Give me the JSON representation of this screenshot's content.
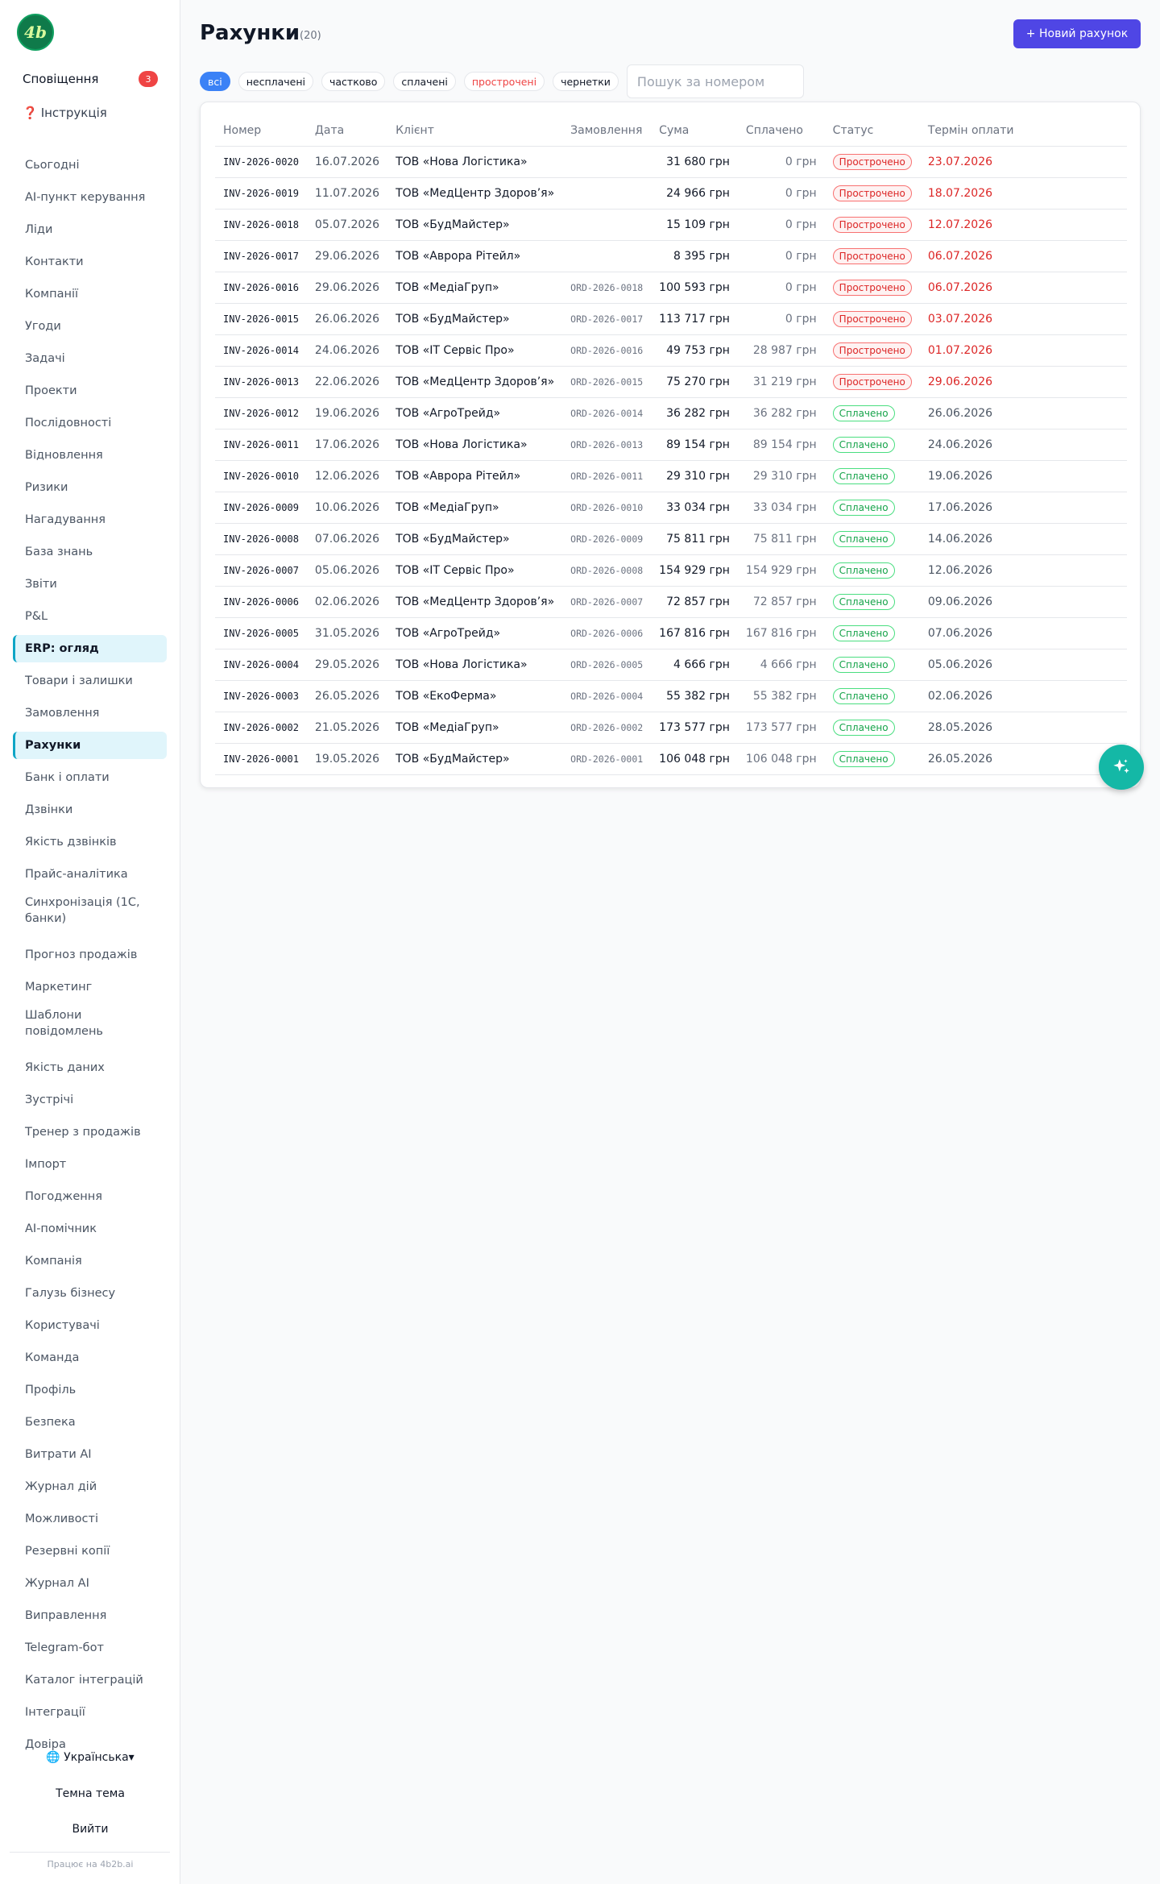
{
  "sidebar": {
    "logo_text": "4b",
    "notifications_label": "Сповіщення",
    "notifications_count": "3",
    "guide_icon": "❓",
    "guide_label": "Інструкція",
    "items": [
      {
        "label": "Сьогодні"
      },
      {
        "label": "AI-пункт керування"
      },
      {
        "label": "Ліди"
      },
      {
        "label": "Контакти"
      },
      {
        "label": "Компанії"
      },
      {
        "label": "Угоди"
      },
      {
        "label": "Задачі"
      },
      {
        "label": "Проекти"
      },
      {
        "label": "Послідовності"
      },
      {
        "label": "Відновлення"
      },
      {
        "label": "Ризики"
      },
      {
        "label": "Нагадування"
      },
      {
        "label": "База знань"
      },
      {
        "label": "Звіти"
      },
      {
        "label": "P&L"
      },
      {
        "label": "ERP: огляд",
        "active": true
      },
      {
        "label": "Товари і залишки"
      },
      {
        "label": "Замовлення"
      },
      {
        "label": "Рахунки",
        "active": true
      },
      {
        "label": "Банк і оплати"
      },
      {
        "label": "Дзвінки"
      },
      {
        "label": "Якість дзвінків"
      },
      {
        "label": "Прайс-аналітика"
      },
      {
        "label": "Синхронізація (1С, банки)"
      },
      {
        "label": "Прогноз продажів"
      },
      {
        "label": "Маркетинг"
      },
      {
        "label": "Шаблони повідомлень"
      },
      {
        "label": "Якість даних"
      },
      {
        "label": "Зустрічі"
      },
      {
        "label": "Тренер з продажів"
      },
      {
        "label": "Імпорт"
      },
      {
        "label": "Погодження"
      },
      {
        "label": "AI-помічник"
      },
      {
        "label": "Компанія"
      },
      {
        "label": "Галузь бізнесу"
      },
      {
        "label": "Користувачі"
      },
      {
        "label": "Команда"
      },
      {
        "label": "Профіль"
      },
      {
        "label": "Безпека"
      },
      {
        "label": "Витрати AI"
      },
      {
        "label": "Журнал дій"
      },
      {
        "label": "Можливості"
      },
      {
        "label": "Резервні копії"
      },
      {
        "label": "Журнал AI"
      },
      {
        "label": "Виправлення"
      },
      {
        "label": "Telegram-бот"
      },
      {
        "label": "Каталог інтеграцій"
      },
      {
        "label": "Інтеграції"
      },
      {
        "label": "Довіра"
      }
    ],
    "language_label": "🌐 Українська▾",
    "theme_label": "Темна тема",
    "logout_label": "Вийти",
    "powered_by": "Працює на 4b2b.ai"
  },
  "header": {
    "title": "Рахунки",
    "count": "(20)",
    "new_button": "+ Новий рахунок"
  },
  "filters": {
    "chips": [
      {
        "label": "всі",
        "active": true
      },
      {
        "label": "несплачені"
      },
      {
        "label": "частково"
      },
      {
        "label": "сплачені"
      },
      {
        "label": "прострочені",
        "danger": true
      },
      {
        "label": "чернетки"
      }
    ],
    "search_placeholder": "Пошук за номером"
  },
  "table": {
    "columns": [
      "Номер",
      "Дата",
      "Клієнт",
      "Замовлення",
      "Сума",
      "Сплачено",
      "Статус",
      "Термін оплати"
    ],
    "rows": [
      {
        "number": "INV-2026-0020",
        "date": "16.07.2026",
        "client": "ТОВ «Нова Логістика»",
        "order": "",
        "sum": "31 680 грн",
        "paid": "0 грн",
        "status": "Прострочено",
        "status_type": "overdue",
        "due": "23.07.2026"
      },
      {
        "number": "INV-2026-0019",
        "date": "11.07.2026",
        "client": "ТОВ «МедЦентр Здоров’я»",
        "order": "",
        "sum": "24 966 грн",
        "paid": "0 грн",
        "status": "Прострочено",
        "status_type": "overdue",
        "due": "18.07.2026"
      },
      {
        "number": "INV-2026-0018",
        "date": "05.07.2026",
        "client": "ТОВ «БудМайстер»",
        "order": "",
        "sum": "15 109 грн",
        "paid": "0 грн",
        "status": "Прострочено",
        "status_type": "overdue",
        "due": "12.07.2026"
      },
      {
        "number": "INV-2026-0017",
        "date": "29.06.2026",
        "client": "ТОВ «Аврора Рітейл»",
        "order": "",
        "sum": "8 395 грн",
        "paid": "0 грн",
        "status": "Прострочено",
        "status_type": "overdue",
        "due": "06.07.2026"
      },
      {
        "number": "INV-2026-0016",
        "date": "29.06.2026",
        "client": "ТОВ «МедіаГруп»",
        "order": "ORD-2026-0018",
        "sum": "100 593 грн",
        "paid": "0 грн",
        "status": "Прострочено",
        "status_type": "overdue",
        "due": "06.07.2026"
      },
      {
        "number": "INV-2026-0015",
        "date": "26.06.2026",
        "client": "ТОВ «БудМайстер»",
        "order": "ORD-2026-0017",
        "sum": "113 717 грн",
        "paid": "0 грн",
        "status": "Прострочено",
        "status_type": "overdue",
        "due": "03.07.2026"
      },
      {
        "number": "INV-2026-0014",
        "date": "24.06.2026",
        "client": "ТОВ «ІТ Сервіс Про»",
        "order": "ORD-2026-0016",
        "sum": "49 753 грн",
        "paid": "28 987 грн",
        "status": "Прострочено",
        "status_type": "overdue",
        "due": "01.07.2026"
      },
      {
        "number": "INV-2026-0013",
        "date": "22.06.2026",
        "client": "ТОВ «МедЦентр Здоров’я»",
        "order": "ORD-2026-0015",
        "sum": "75 270 грн",
        "paid": "31 219 грн",
        "status": "Прострочено",
        "status_type": "overdue",
        "due": "29.06.2026"
      },
      {
        "number": "INV-2026-0012",
        "date": "19.06.2026",
        "client": "ТОВ «АгроТрейд»",
        "order": "ORD-2026-0014",
        "sum": "36 282 грн",
        "paid": "36 282 грн",
        "status": "Сплачено",
        "status_type": "paid",
        "due": "26.06.2026"
      },
      {
        "number": "INV-2026-0011",
        "date": "17.06.2026",
        "client": "ТОВ «Нова Логістика»",
        "order": "ORD-2026-0013",
        "sum": "89 154 грн",
        "paid": "89 154 грн",
        "status": "Сплачено",
        "status_type": "paid",
        "due": "24.06.2026"
      },
      {
        "number": "INV-2026-0010",
        "date": "12.06.2026",
        "client": "ТОВ «Аврора Рітейл»",
        "order": "ORD-2026-0011",
        "sum": "29 310 грн",
        "paid": "29 310 грн",
        "status": "Сплачено",
        "status_type": "paid",
        "due": "19.06.2026"
      },
      {
        "number": "INV-2026-0009",
        "date": "10.06.2026",
        "client": "ТОВ «МедіаГруп»",
        "order": "ORD-2026-0010",
        "sum": "33 034 грн",
        "paid": "33 034 грн",
        "status": "Сплачено",
        "status_type": "paid",
        "due": "17.06.2026"
      },
      {
        "number": "INV-2026-0008",
        "date": "07.06.2026",
        "client": "ТОВ «БудМайстер»",
        "order": "ORD-2026-0009",
        "sum": "75 811 грн",
        "paid": "75 811 грн",
        "status": "Сплачено",
        "status_type": "paid",
        "due": "14.06.2026"
      },
      {
        "number": "INV-2026-0007",
        "date": "05.06.2026",
        "client": "ТОВ «ІТ Сервіс Про»",
        "order": "ORD-2026-0008",
        "sum": "154 929 грн",
        "paid": "154 929 грн",
        "status": "Сплачено",
        "status_type": "paid",
        "due": "12.06.2026"
      },
      {
        "number": "INV-2026-0006",
        "date": "02.06.2026",
        "client": "ТОВ «МедЦентр Здоров’я»",
        "order": "ORD-2026-0007",
        "sum": "72 857 грн",
        "paid": "72 857 грн",
        "status": "Сплачено",
        "status_type": "paid",
        "due": "09.06.2026"
      },
      {
        "number": "INV-2026-0005",
        "date": "31.05.2026",
        "client": "ТОВ «АгроТрейд»",
        "order": "ORD-2026-0006",
        "sum": "167 816 грн",
        "paid": "167 816 грн",
        "status": "Сплачено",
        "status_type": "paid",
        "due": "07.06.2026"
      },
      {
        "number": "INV-2026-0004",
        "date": "29.05.2026",
        "client": "ТОВ «Нова Логістика»",
        "order": "ORD-2026-0005",
        "sum": "4 666 грн",
        "paid": "4 666 грн",
        "status": "Сплачено",
        "status_type": "paid",
        "due": "05.06.2026"
      },
      {
        "number": "INV-2026-0003",
        "date": "26.05.2026",
        "client": "ТОВ «ЕкоФерма»",
        "order": "ORD-2026-0004",
        "sum": "55 382 грн",
        "paid": "55 382 грн",
        "status": "Сплачено",
        "status_type": "paid",
        "due": "02.06.2026"
      },
      {
        "number": "INV-2026-0002",
        "date": "21.05.2026",
        "client": "ТОВ «МедіаГруп»",
        "order": "ORD-2026-0002",
        "sum": "173 577 грн",
        "paid": "173 577 грн",
        "status": "Сплачено",
        "status_type": "paid",
        "due": "28.05.2026"
      },
      {
        "number": "INV-2026-0001",
        "date": "19.05.2026",
        "client": "ТОВ «БудМайстер»",
        "order": "ORD-2026-0001",
        "sum": "106 048 грн",
        "paid": "106 048 грн",
        "status": "Сплачено",
        "status_type": "paid",
        "due": "26.05.2026"
      }
    ]
  },
  "fab": {
    "icon": "sparkles-icon"
  },
  "colors": {
    "accent": "#4f46e5",
    "active_chip": "#3b82f6",
    "overdue": "#dc2626",
    "paid": "#16a34a",
    "fab": "#14b8a6"
  }
}
